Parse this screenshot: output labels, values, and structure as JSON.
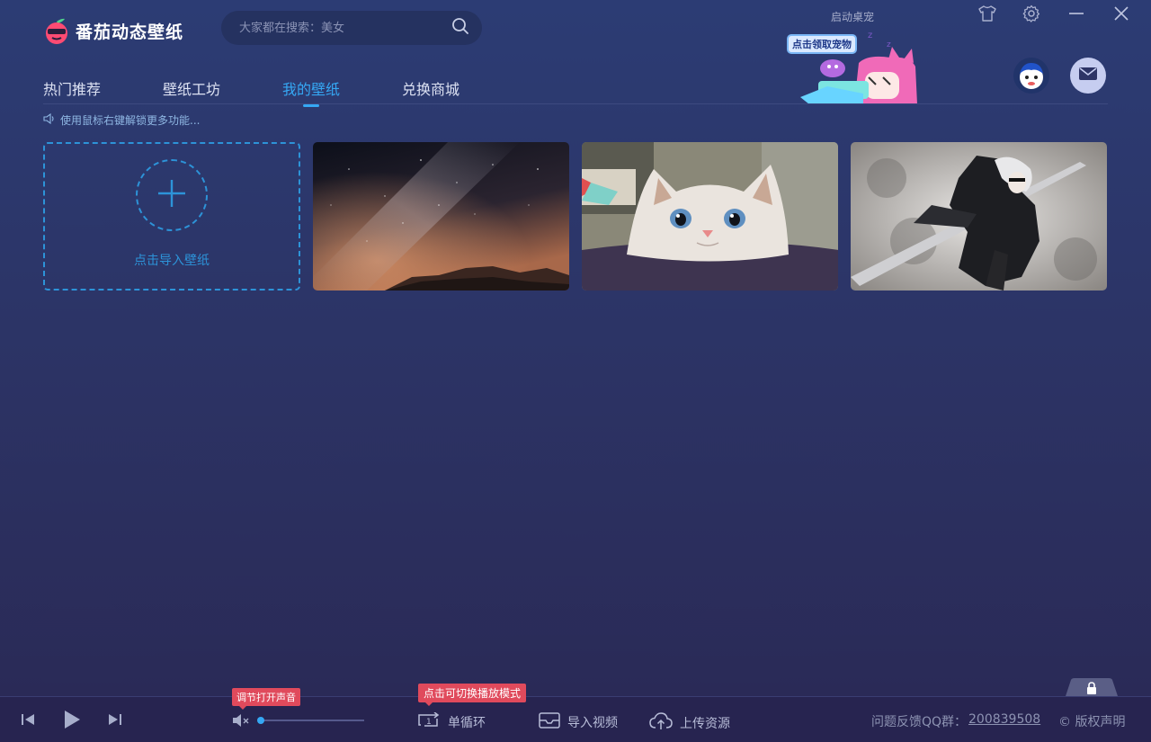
{
  "app": {
    "logo_text": "番茄动态壁纸",
    "search_placeholder": "大家都在搜索：美女",
    "launch_pet_label": "启动桌宠"
  },
  "nav": {
    "items": [
      {
        "label": "热门推荐"
      },
      {
        "label": "壁纸工坊"
      },
      {
        "label": "我的壁纸",
        "active": true
      },
      {
        "label": "兑换商城"
      }
    ]
  },
  "pet_banner": {
    "tip": "点击领取宠物"
  },
  "hint": "使用鼠标右键解锁更多功能...",
  "wallpapers": {
    "import_label": "点击导入壁纸",
    "items": [
      {
        "name": "starry-sky-wallpaper"
      },
      {
        "name": "cat-wallpaper"
      },
      {
        "name": "anime-swordswoman-wallpaper"
      }
    ]
  },
  "player": {
    "volume_tooltip": "调节打开声音",
    "volume_level": 0.0,
    "mode_tooltip": "点击可切换播放模式",
    "loop_mode": "单循环",
    "import_video": "导入视频",
    "upload_resource": "上传资源",
    "feedback_label": "问题反馈QQ群：",
    "qq_group": "200839508",
    "copyright": "© 版权声明"
  },
  "colors": {
    "accent": "#35a8f4",
    "tooltip": "#e04a5c",
    "background": "#2c3466"
  },
  "icons": [
    "app-logo-icon",
    "search-icon",
    "shirt-icon",
    "gear-icon",
    "minimize-icon",
    "close-icon",
    "mail-icon",
    "speaker-icon",
    "plus-icon",
    "prev-icon",
    "play-icon",
    "next-icon",
    "mute-icon",
    "loop-icon",
    "import-video-icon",
    "upload-cloud-icon",
    "lock-icon"
  ]
}
